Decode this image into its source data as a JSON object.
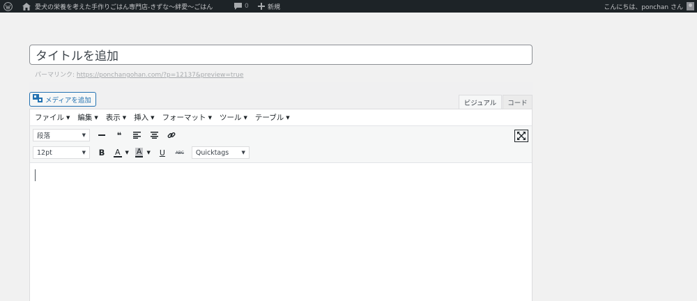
{
  "adminbar": {
    "site_name": "愛犬の栄養を考えた手作りごはん専門店-きずな〜絆愛〜ごはん",
    "comments_count": "0",
    "new_label": "新規",
    "greeting": "こんにちは、ponchan さん",
    "icons": [
      "wordpress-logo-icon",
      "home-icon",
      "comment-icon",
      "plus-icon",
      "avatar-icon"
    ]
  },
  "post": {
    "title_placeholder": "タイトルを追加",
    "permalink_label": "パーマリンク:",
    "permalink_url": "https://ponchangohan.com/?p=12137&preview=true"
  },
  "editor": {
    "add_media_label": "メディアを追加",
    "tab_visual": "ビジュアル",
    "tab_code": "コード",
    "menus": [
      "ファイル",
      "編集",
      "表示",
      "挿入",
      "フォーマット",
      "ツール",
      "テーブル"
    ],
    "format_value": "段落",
    "font_size_value": "12pt",
    "quicktags_value": "Quicktags",
    "blockquote_glyph": "❝",
    "bold_glyph": "B",
    "text_color_glyph": "A",
    "bg_color_glyph": "A",
    "underline_glyph": "U",
    "strike_glyph": "ABC"
  }
}
